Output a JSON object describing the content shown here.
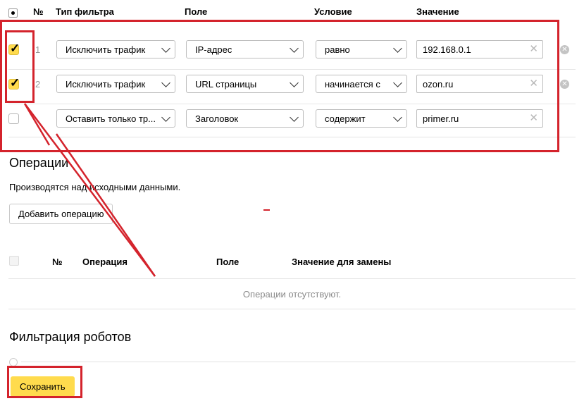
{
  "filters_table": {
    "headers": {
      "num": "№",
      "type": "Тип фильтра",
      "field": "Поле",
      "condition": "Условие",
      "value": "Значение"
    },
    "rows": [
      {
        "checked": true,
        "num": "1",
        "type": "Исключить трафик",
        "field": "IP-адрес",
        "condition": "равно",
        "value": "192.168.0.1"
      },
      {
        "checked": true,
        "num": "2",
        "type": "Исключить трафик",
        "field": "URL страницы",
        "condition": "начинается с",
        "value": "ozon.ru"
      },
      {
        "checked": false,
        "num": "",
        "type": "Оставить только тр...",
        "field": "Заголовок",
        "condition": "содержит",
        "value": "primer.ru"
      }
    ]
  },
  "operations": {
    "title": "Операции",
    "description": "Производятся над исходными данными.",
    "add_button": "Добавить операцию",
    "headers": {
      "num": "№",
      "operation": "Операция",
      "field": "Поле",
      "replace_value": "Значение для замены"
    },
    "empty_text": "Операции отсутствуют."
  },
  "robots": {
    "title": "Фильтрация роботов"
  },
  "save_button": "Сохранить",
  "colors": {
    "annotation_red": "#d4232c",
    "accent_yellow": "#ffdb4d"
  }
}
